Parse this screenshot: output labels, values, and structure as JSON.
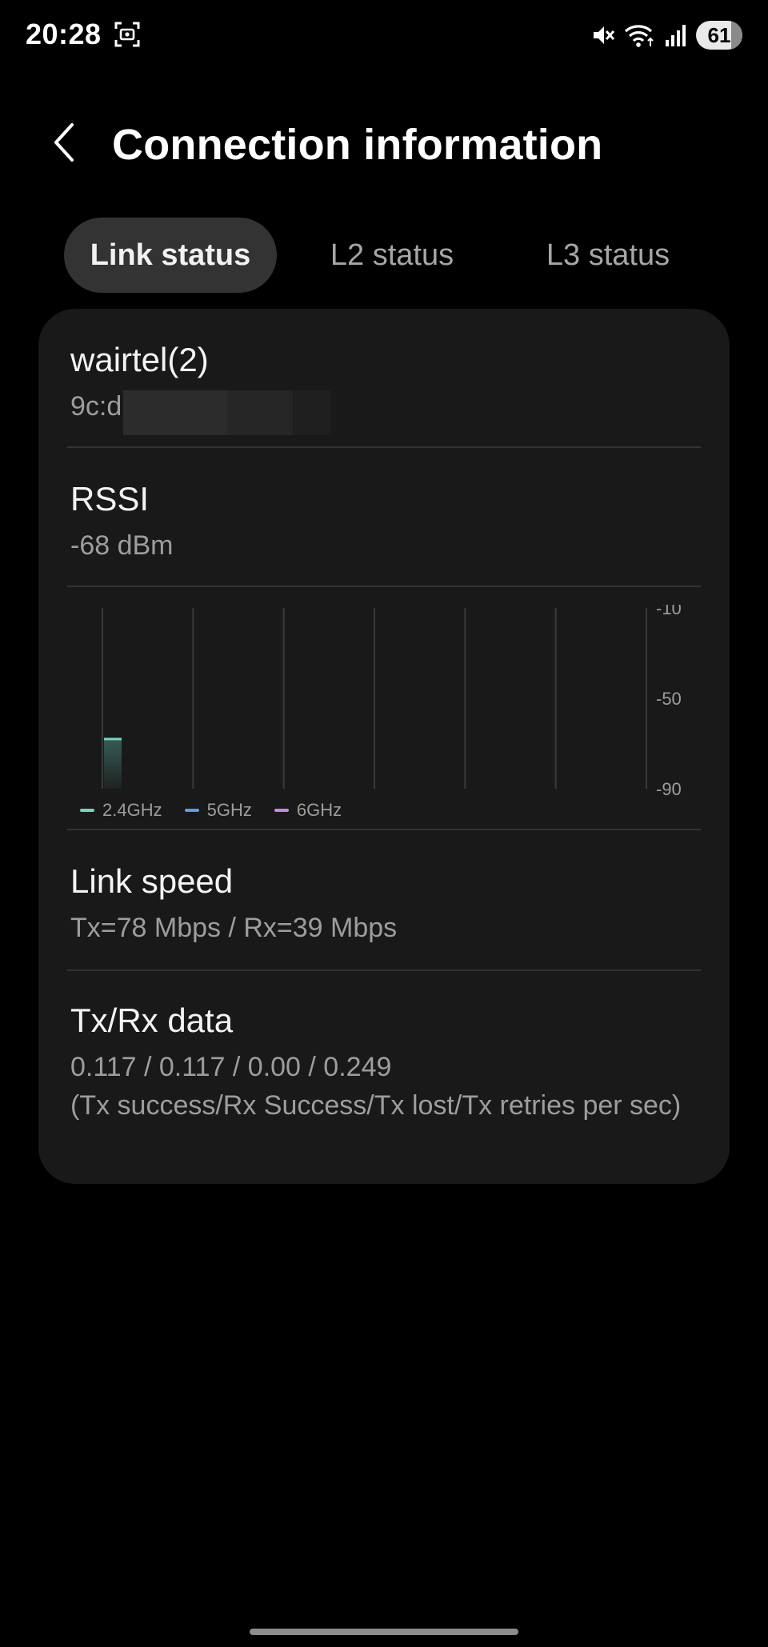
{
  "status_bar": {
    "time": "20:28",
    "battery": "61",
    "icons": [
      "screenshot-icon",
      "mute-icon",
      "wifi-icon",
      "signal-icon",
      "battery-icon"
    ]
  },
  "header": {
    "title": "Connection information",
    "back_icon": "chevron-left-icon"
  },
  "tabs": [
    {
      "label": "Link status",
      "active": true
    },
    {
      "label": "L2 status",
      "active": false
    },
    {
      "label": "L3 status",
      "active": false
    }
  ],
  "network": {
    "ssid": "wairtel(2)",
    "mac": "9c:d"
  },
  "rssi": {
    "title": "RSSI",
    "value": "-68 dBm"
  },
  "chart_data": {
    "type": "bar",
    "y_tick_labels": [
      "-10",
      "-50",
      "-90"
    ],
    "ylim": [
      -90,
      -10
    ],
    "vertical_grid_lines": 7,
    "series": [
      {
        "name": "2.4GHz",
        "color": "#6fd6c2",
        "values": [
          -68
        ]
      },
      {
        "name": "5GHz",
        "color": "#4fa3f0",
        "values": []
      },
      {
        "name": "6GHz",
        "color": "#c888e8",
        "values": []
      }
    ],
    "legend_placement": "bottom-left"
  },
  "link_speed": {
    "title": "Link speed",
    "value": "Tx=78 Mbps / Rx=39 Mbps"
  },
  "txrx": {
    "title": "Tx/Rx data",
    "value": "0.117 / 0.117 / 0.00 / 0.249",
    "note": "(Tx success/Rx Success/Tx lost/Tx retries per sec)"
  },
  "colors": {
    "background": "#000000",
    "card": "#191919",
    "tab_active": "#333333",
    "divider": "#333333"
  }
}
